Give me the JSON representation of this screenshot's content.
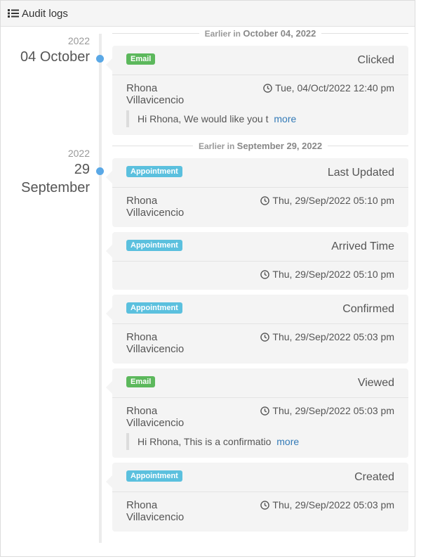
{
  "header": {
    "title": "Audit logs",
    "icon": "list-icon"
  },
  "groups": [
    {
      "year": "2022",
      "date_line1": "04 October",
      "date_line2": "",
      "separator_prefix": "Earlier in",
      "separator_date": "October 04, 2022",
      "entries": [
        {
          "badge": "Email",
          "status": "Clicked",
          "person_first": "Rhona",
          "person_last": "Villavicencio",
          "time": "Tue, 04/Oct/2022 12:40 pm",
          "message": "Hi Rhona, We would like you t",
          "more": "more"
        }
      ]
    },
    {
      "year": "2022",
      "date_line1": "29",
      "date_line2": "September",
      "separator_prefix": "Earlier in",
      "separator_date": "September 29, 2022",
      "entries": [
        {
          "badge": "Appointment",
          "status": "Last Updated",
          "person_first": "Rhona",
          "person_last": "Villavicencio",
          "time": "Thu, 29/Sep/2022 05:10 pm"
        },
        {
          "badge": "Appointment",
          "status": "Arrived Time",
          "person_first": "",
          "person_last": "",
          "time": "Thu, 29/Sep/2022 05:10 pm"
        },
        {
          "badge": "Appointment",
          "status": "Confirmed",
          "person_first": "Rhona",
          "person_last": "Villavicencio",
          "time": "Thu, 29/Sep/2022 05:03 pm"
        },
        {
          "badge": "Email",
          "status": "Viewed",
          "person_first": "Rhona",
          "person_last": "Villavicencio",
          "time": "Thu, 29/Sep/2022 05:03 pm",
          "message": "Hi Rhona, This is a confirmatio",
          "more": "more"
        },
        {
          "badge": "Appointment",
          "status": "Created",
          "person_first": "Rhona",
          "person_last": "Villavicencio",
          "time": "Thu, 29/Sep/2022 05:03 pm"
        }
      ]
    }
  ],
  "colors": {
    "email_badge": "#5cb85c",
    "appointment_badge": "#5bc0de",
    "dot": "#5aa8e6",
    "link": "#337ab7"
  }
}
